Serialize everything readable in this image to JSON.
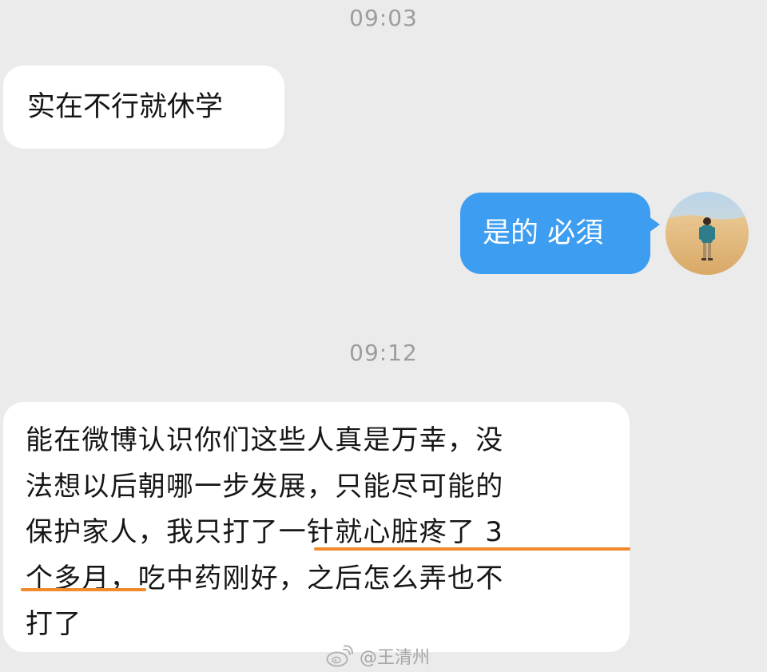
{
  "timestamps": [
    "09:03",
    "09:12"
  ],
  "messages": [
    {
      "side": "left",
      "text": "实在不行就休学"
    },
    {
      "side": "right",
      "text": "是的 必須"
    },
    {
      "side": "left",
      "lines": [
        "能在微博认识你们这些人真是万幸，没",
        "法想以后朝哪一步发展，只能尽可能的",
        "保护家人，我只打了一针就心脏疼了 3",
        "个多月，吃中药刚好，之后怎么弄也不",
        "打了"
      ]
    }
  ],
  "highlight_color": "#f08a2c",
  "bubble_colors": {
    "received": "#ffffff",
    "sent": "#3d9df1"
  },
  "avatar_icon": "desert-person-avatar",
  "watermark": {
    "icon": "weibo-logo-icon",
    "text": "@王清州"
  }
}
